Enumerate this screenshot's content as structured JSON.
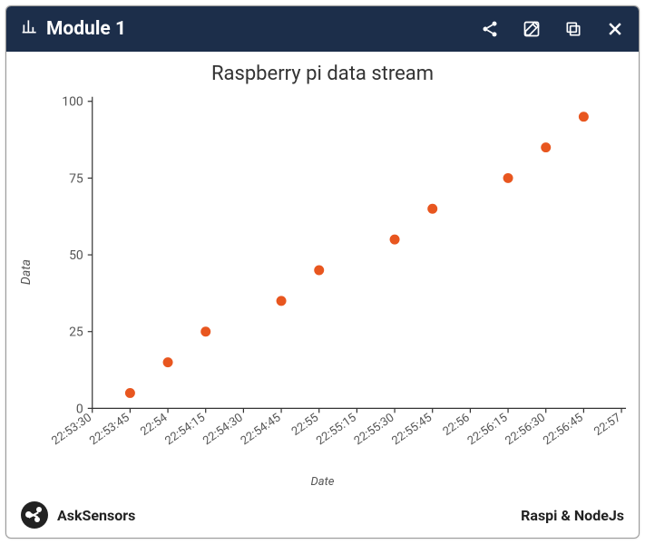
{
  "header": {
    "title": "Module 1",
    "icons": {
      "share": "share-icon",
      "edit": "edit-icon",
      "copy": "copy-icon",
      "close": "close-icon",
      "bar": "bar-chart-icon"
    }
  },
  "footer": {
    "brand": "AskSensors",
    "right": "Raspi & NodeJs"
  },
  "chart_data": {
    "type": "scatter",
    "title": "Raspberry pi data stream",
    "xlabel": "Date",
    "ylabel": "Data",
    "ylim": [
      0,
      100
    ],
    "yticks": [
      0,
      25,
      50,
      75,
      100
    ],
    "xticks": [
      "22:53:30",
      "22:53:45",
      "22:54",
      "22:54:15",
      "22:54:30",
      "22:54:45",
      "22:55",
      "22:55:15",
      "22:55:30",
      "22:55:45",
      "22:56",
      "22:56:15",
      "22:56:30",
      "22:56:45",
      "22:57"
    ],
    "series": [
      {
        "name": "Data",
        "color": "#e8561f",
        "points": [
          {
            "x": "22:53:45",
            "y": 5
          },
          {
            "x": "22:54",
            "y": 15
          },
          {
            "x": "22:54:15",
            "y": 25
          },
          {
            "x": "22:54:45",
            "y": 35
          },
          {
            "x": "22:55",
            "y": 45
          },
          {
            "x": "22:55:30",
            "y": 55
          },
          {
            "x": "22:55:45",
            "y": 65
          },
          {
            "x": "22:56:15",
            "y": 75
          },
          {
            "x": "22:56:30",
            "y": 85
          },
          {
            "x": "22:56:45",
            "y": 95
          }
        ]
      }
    ]
  }
}
